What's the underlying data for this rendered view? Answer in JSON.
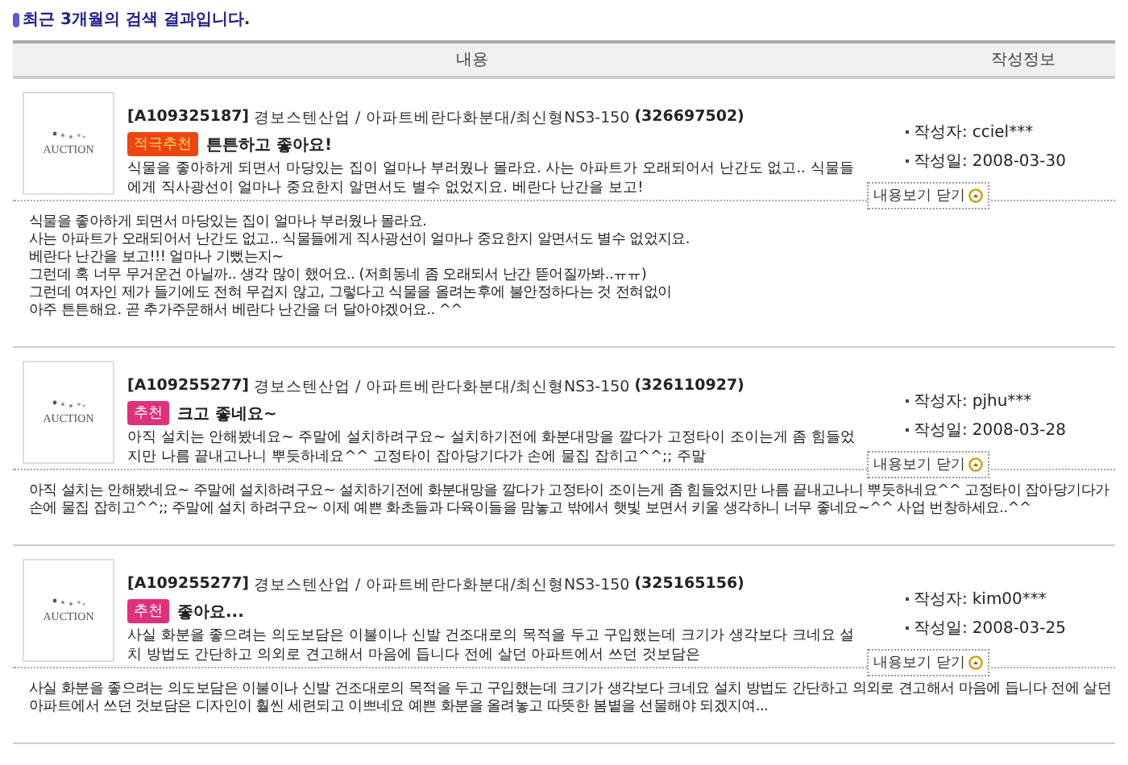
{
  "title": "최근 3개월의 검색 결과입니다.",
  "columns": [
    "내용",
    "작성정보"
  ],
  "reviews": [
    {
      "thumb": "AUCTION",
      "code": "[A109325187]",
      "product": "경보스텐산업 / 아파트베란다화분대/최신형NS3-150",
      "order": "(326697502)",
      "badge": {
        "kind": "strong",
        "label": "적극추천"
      },
      "headline": "튼튼하고 좋아요!",
      "snippet": "식물을 좋아하게 되면서 마당있는 집이 얼마나 부러웠나 몰라요. 사는 아파트가 오래되어서 난간도 없고.. 식물들에게 직사광선이 얼마나 중요한지 알면서도 별수 없었지요. 베란다 난간을 보고!",
      "author_label": "작성자:",
      "author": "cciel***",
      "date_label": "작성일:",
      "date": "2008-03-30",
      "toggle": "내용보기 닫기",
      "full": [
        "식물을 좋아하게 되면서 마당있는 집이 얼마나 부러웠나 몰라요.",
        "사는 아파트가 오래되어서 난간도 없고.. 식물들에게 직사광선이 얼마나 중요한지 알면서도 별수 없었지요.",
        "베란다 난간을 보고!!! 얼마나 기뻤는지~",
        "그런데 혹 너무 무거운건 아닐까.. 생각 많이 했어요.. (저희동네 좀 오래되서 난간 뜯어질까봐..ㅠㅠ)",
        "그런데 여자인 제가 들기에도 전혀 무겁지 않고, 그렇다고 식물을 올려논후에 불안정하다는 것 전혀없이",
        "아주 튼튼해요. 곧 추가주문해서 베란다 난간을 더 달아야겠어요.. ^^"
      ]
    },
    {
      "thumb": "AUCTION",
      "code": "[A109255277]",
      "product": "경보스텐산업 / 아파트베란다화분대/최신형NS3-150",
      "order": "(326110927)",
      "badge": {
        "kind": "normal",
        "label": "추천"
      },
      "headline": "크고 좋네요~",
      "snippet": "아직 설치는 안해봤네요~ 주말에 설치하려구요~ 설치하기전에 화분대망을 깔다가 고정타이 조이는게 좀 힘들었지만 나름 끝내고나니 뿌듯하네요^^ 고정타이 잡아당기다가 손에 물집 잡히고^^;; 주말",
      "author_label": "작성자:",
      "author": "pjhu***",
      "date_label": "작성일:",
      "date": "2008-03-28",
      "toggle": "내용보기 닫기",
      "full": [
        "아직 설치는 안해봤네요~ 주말에 설치하려구요~ 설치하기전에 화분대망을 깔다가 고정타이 조이는게 좀 힘들었지만 나름 끝내고나니 뿌듯하네요^^ 고정타이 잡아당기다가 손에 물집 잡히고^^;; 주말에 설치 하려구요~ 이제 예쁜 화초들과 다육이들을 맘놓고 밖에서 햇빛 보면서 키울 생각하니 너무 좋네요~^^ 사업 번창하세요..^^"
      ]
    },
    {
      "thumb": "AUCTION",
      "code": "[A109255277]",
      "product": "경보스텐산업 / 아파트베란다화분대/최신형NS3-150",
      "order": "(325165156)",
      "badge": {
        "kind": "normal",
        "label": "추천"
      },
      "headline": "좋아요...",
      "snippet": "사실 화분을 좋으려는 의도보담은 이불이나 신발 건조대로의 목적을 두고 구입했는데 크기가 생각보다 크네요 설치 방법도 간단하고 의외로 견고해서 마음에 듭니다 전에 살던 아파트에서 쓰던 것보담은",
      "author_label": "작성자:",
      "author": "kim00***",
      "date_label": "작성일:",
      "date": "2008-03-25",
      "toggle": "내용보기 닫기",
      "full": [
        "사실 화분을 좋으려는 의도보담은 이불이나 신발 건조대로의 목적을 두고 구입했는데 크기가 생각보다 크네요 설치 방법도 간단하고 의외로 견고해서 마음에 듭니다 전에 살던 아파트에서 쓰던 것보담은 디자인이 훨씬 세련되고 이쁘네요 예쁜 화분을 올려놓고 따뜻한 봄볕을 선물해야 되겠지여..."
      ]
    }
  ]
}
